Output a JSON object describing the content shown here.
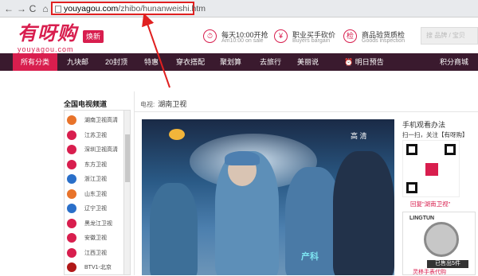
{
  "browser": {
    "url_host": "youyagou.com",
    "url_path": "/zhibo/hunanweishi.htm",
    "back_label": "←",
    "forward_label": "→",
    "reload_label": "C",
    "home_label": "⌂"
  },
  "header": {
    "logo_text": "有呀购",
    "logo_sub": "youyagou.com",
    "badge": "焕新",
    "promos": [
      {
        "icon": "⏱",
        "title": "每天10:00开抢",
        "sub": "Am10:00 on sale"
      },
      {
        "icon": "¥",
        "title": "职业买手砍价",
        "sub": "Buyers bargain"
      },
      {
        "icon": "检",
        "title": "商品验货质检",
        "sub": "Goods inspection"
      }
    ],
    "search_placeholder": "搜 品牌 / 宝贝"
  },
  "nav": {
    "items": [
      "所有分类",
      "九块邮",
      "20封顶",
      "特惠",
      "穿衣搭配",
      "聚划算",
      "去旅行",
      "美丽说",
      "明日预告",
      "积分商城"
    ]
  },
  "sidebar": {
    "title": "全国电视频道",
    "channels": [
      {
        "name": "湖南卫视高清",
        "color": "#e8732a"
      },
      {
        "name": "江苏卫视",
        "color": "#d81e4e"
      },
      {
        "name": "深圳卫视高清",
        "color": "#d81e4e"
      },
      {
        "name": "东方卫视",
        "color": "#d81e4e"
      },
      {
        "name": "浙江卫视",
        "color": "#2a6fc9"
      },
      {
        "name": "山东卫视",
        "color": "#e8732a"
      },
      {
        "name": "辽宁卫视",
        "color": "#2a6fc9"
      },
      {
        "name": "黑龙江卫视",
        "color": "#d81e4e"
      },
      {
        "name": "安徽卫视",
        "color": "#d81e4e"
      },
      {
        "name": "江西卫视",
        "color": "#d81e4e"
      },
      {
        "name": "BTV1-北京",
        "color": "#b01818"
      }
    ]
  },
  "main": {
    "tv_label": "电视:",
    "tv_name": "湖南卫视",
    "video_hd": "高 清",
    "video_caption": "产科"
  },
  "right": {
    "title": "手机观看办法",
    "scan_text": "扫一扫，关注【有呀购】",
    "qr_note": "回复\"湖南卫视\"",
    "ad_brand": "LINGTUN",
    "ad_sold": "已售出5件",
    "ad_name": "灵移手表代购"
  },
  "colors": {
    "accent": "#d81e4e",
    "nav_bg": "#3a1a2e",
    "annotation": "#e02020"
  }
}
